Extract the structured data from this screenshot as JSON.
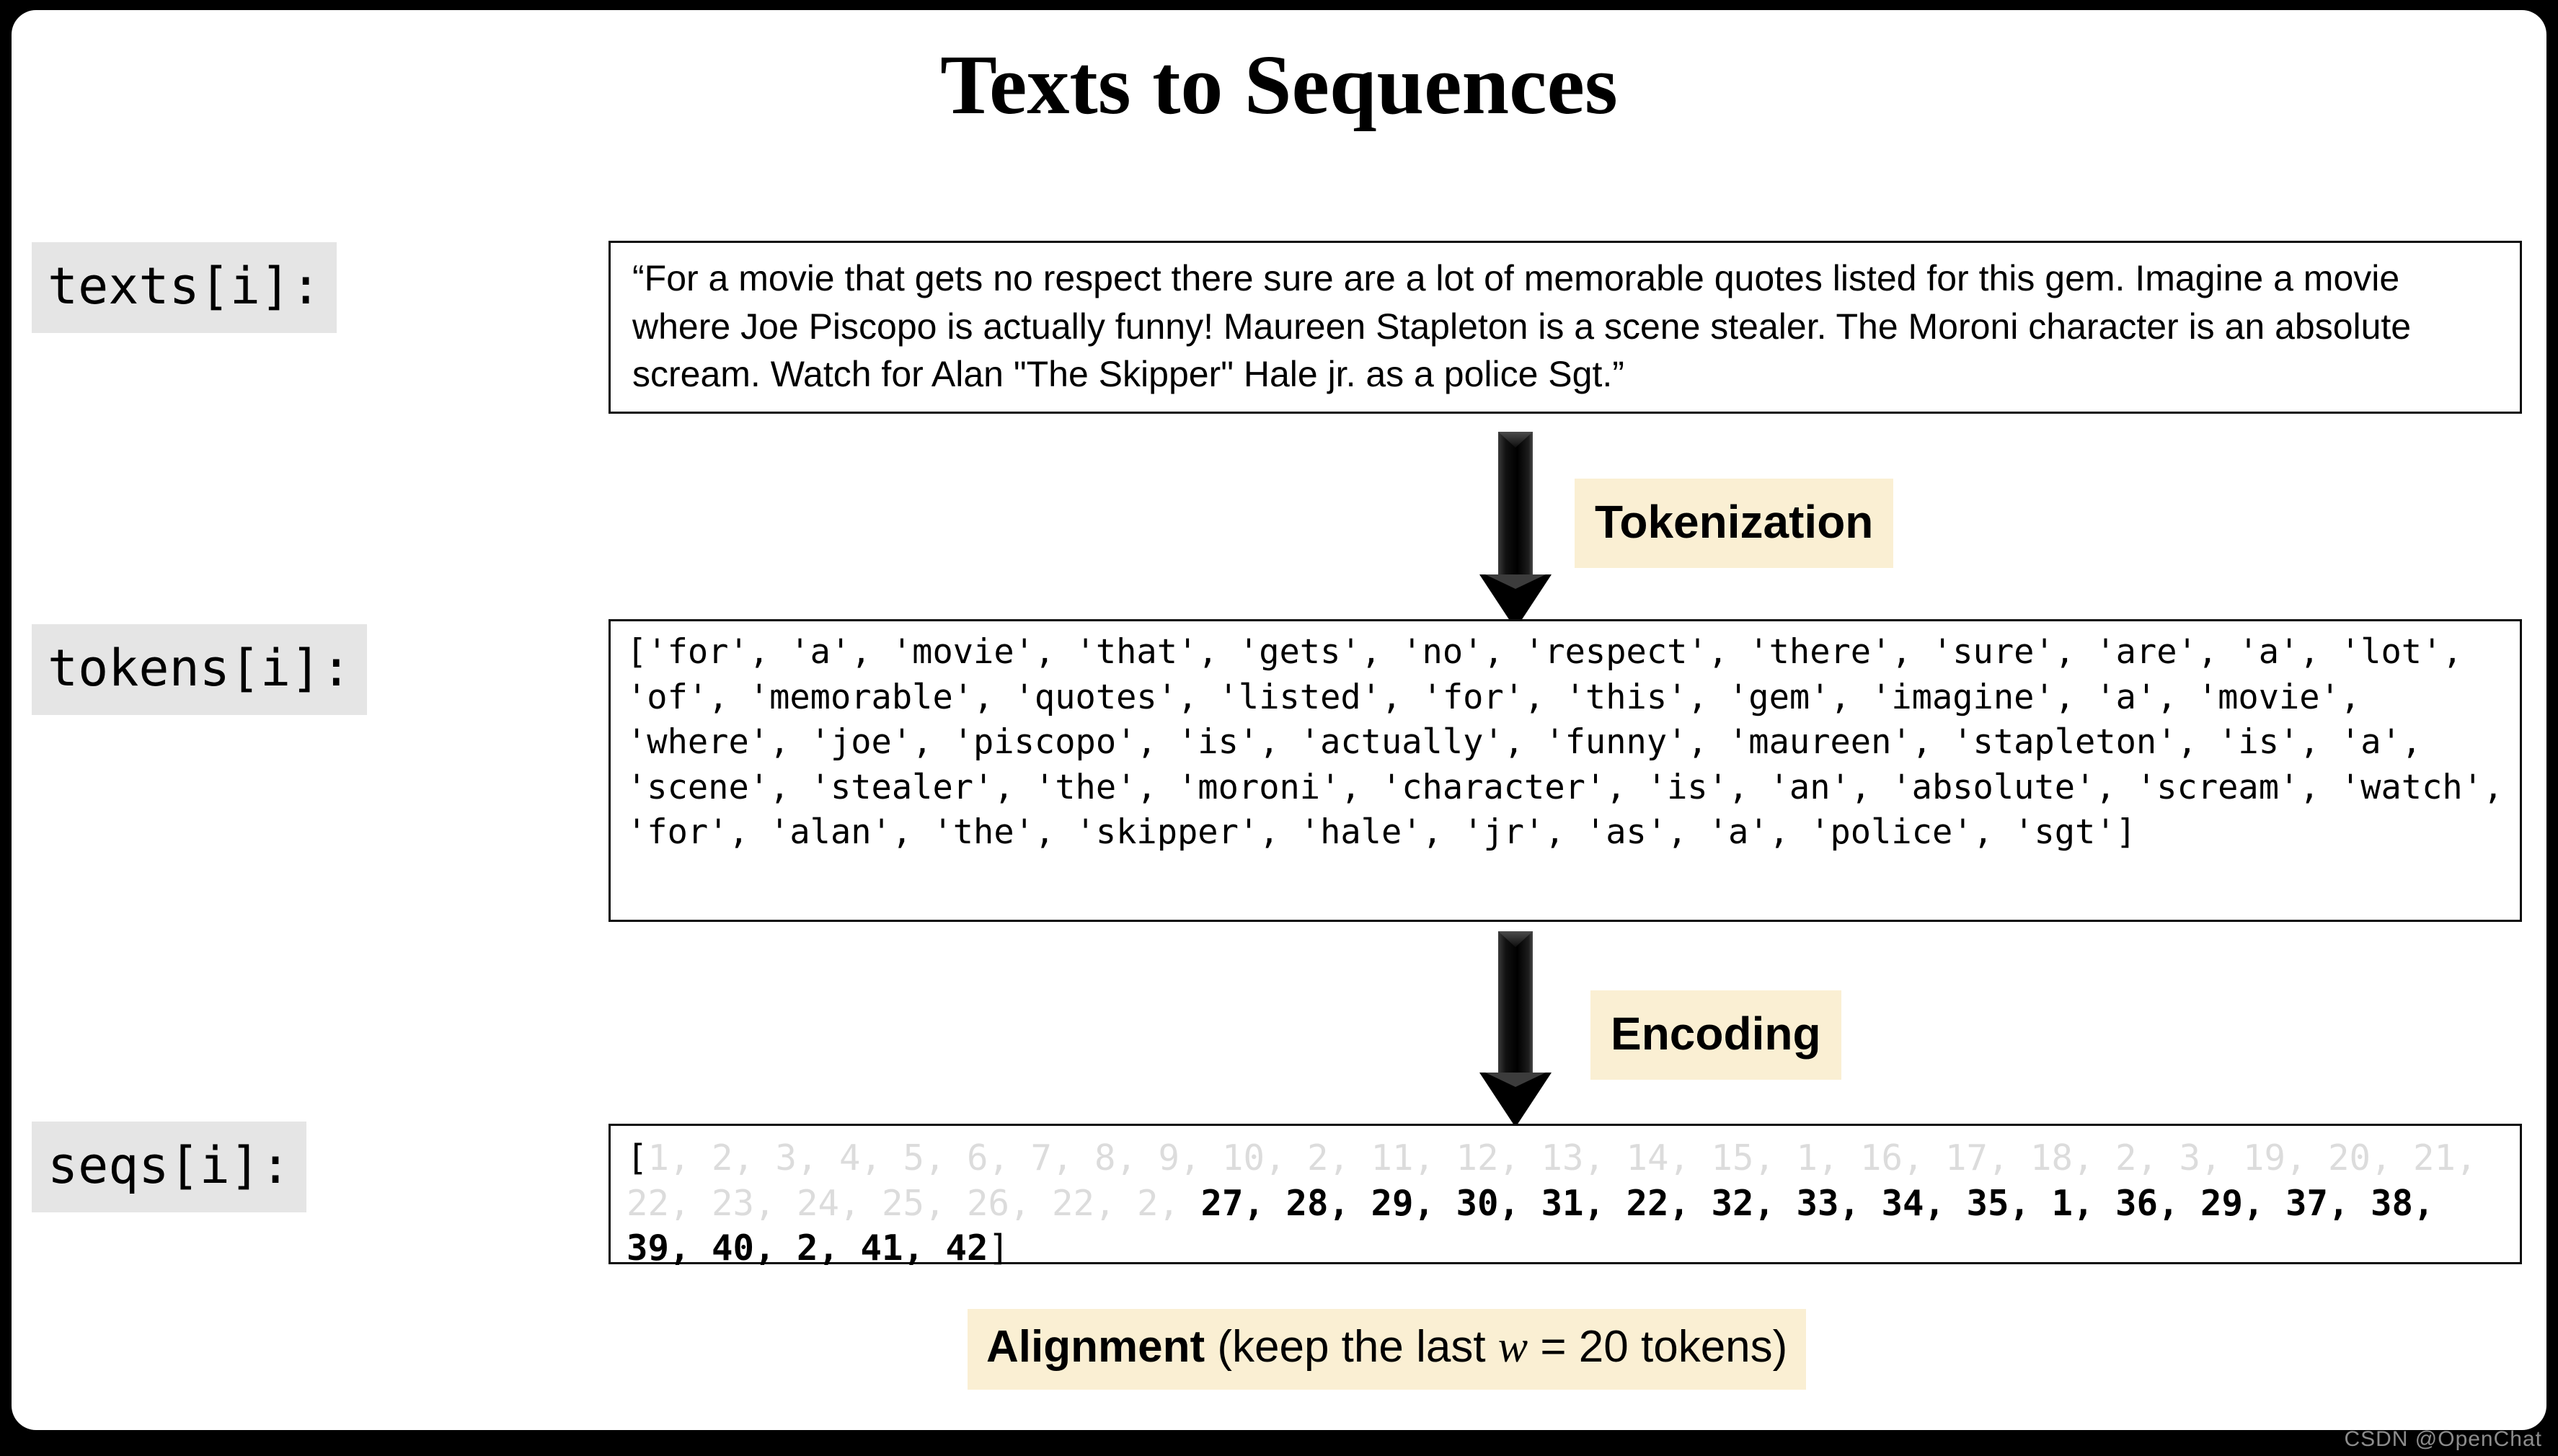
{
  "slide": {
    "title": "Texts to Sequences",
    "watermark": "CSDN @OpenChat"
  },
  "colors": {
    "page_background": "#000000",
    "slide_background": "#ffffff",
    "label_chip": "#e5e5e5",
    "stage_highlight": "#faefd3",
    "box_border": "#0b0b0b",
    "faded_token": "#dcdcdc",
    "text": "#000000"
  },
  "rows": {
    "texts": {
      "label": "texts[i]:",
      "value": "“For a movie that gets no respect there sure are a lot of memorable quotes listed for this gem. Imagine a movie where Joe Piscopo is actually funny! Maureen Stapleton is a scene stealer. The Moroni character is an absolute scream. Watch for Alan \"The Skipper\" Hale jr. as a police Sgt.”"
    },
    "tokens": {
      "label": "tokens[i]:",
      "value": "['for', 'a', 'movie', 'that', 'gets', 'no', 'respect', 'there', 'sure', 'are', 'a', 'lot', 'of', 'memorable', 'quotes', 'listed', 'for', 'this', 'gem', 'imagine', 'a', 'movie', 'where', 'joe', 'piscopo', 'is', 'actually', 'funny', 'maureen', 'stapleton', 'is', 'a', 'scene', 'stealer', 'the', 'moroni', 'character', 'is', 'an', 'absolute', 'scream', 'watch', 'for', 'alan', 'the', 'skipper', 'hale', 'jr', 'as', 'a', 'police', 'sgt']"
    },
    "seqs": {
      "label": "seqs[i]:",
      "open_bracket": "[",
      "close_bracket": "]",
      "dropped": "1, 2, 3, 4, 5, 6, 7, 8, 9, 10, 2, 11, 12, 13, 14, 15, 1, 16, 17, 18, 2, 3, 19, 20, 21, 22, 23, 24, 25, 26, 22, 2, ",
      "kept": "27, 28, 29, 30, 31, 22, 32, 33, 34, 35, 1, 36, 29, 37, 38, 39, 40, 2, 41, 42"
    }
  },
  "stages": [
    {
      "id": "tokenization",
      "label": "Tokenization"
    },
    {
      "id": "encoding",
      "label": "Encoding"
    }
  ],
  "alignment": {
    "bold_text": "Alignment",
    "prefix": " (keep the last ",
    "variable": "w",
    "equation": " = 20 tokens)"
  },
  "chart_data": {
    "type": "table",
    "title": "Texts to Sequences",
    "pipeline": [
      "texts[i]",
      "tokens[i]",
      "seqs[i]"
    ],
    "transforms": [
      "Tokenization",
      "Encoding",
      "Alignment"
    ],
    "window_size": 20,
    "token_count_total": 52,
    "dropped_ids": [
      1,
      2,
      3,
      4,
      5,
      6,
      7,
      8,
      9,
      10,
      2,
      11,
      12,
      13,
      14,
      15,
      1,
      16,
      17,
      18,
      2,
      3,
      19,
      20,
      21,
      22,
      23,
      24,
      25,
      26,
      22,
      2
    ],
    "kept_ids": [
      27,
      28,
      29,
      30,
      31,
      22,
      32,
      33,
      34,
      35,
      1,
      36,
      29,
      37,
      38,
      39,
      40,
      2,
      41,
      42
    ]
  }
}
